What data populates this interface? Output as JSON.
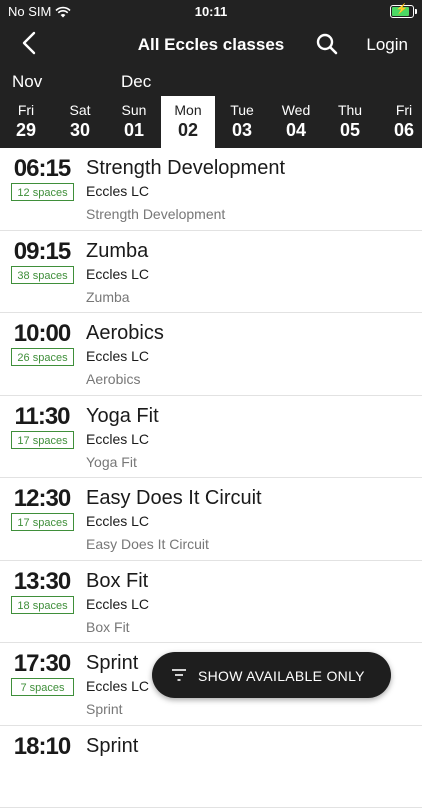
{
  "status": {
    "carrier": "No SIM",
    "time": "10:11"
  },
  "nav": {
    "title": "All Eccles classes",
    "login": "Login",
    "back_icon": "back-chevron-icon",
    "search_icon": "search-icon"
  },
  "months": {
    "first": "Nov",
    "second": "Dec"
  },
  "days": [
    {
      "wd": "Fri",
      "dn": "29"
    },
    {
      "wd": "Sat",
      "dn": "30"
    },
    {
      "wd": "Sun",
      "dn": "01"
    },
    {
      "wd": "Mon",
      "dn": "02"
    },
    {
      "wd": "Tue",
      "dn": "03"
    },
    {
      "wd": "Wed",
      "dn": "04"
    },
    {
      "wd": "Thu",
      "dn": "05"
    },
    {
      "wd": "Fri",
      "dn": "06"
    }
  ],
  "selected_day_index": 3,
  "classes": [
    {
      "time": "06:15",
      "spaces": "12 spaces",
      "name": "Strength Development",
      "venue": "Eccles LC",
      "type": "Strength Development"
    },
    {
      "time": "09:15",
      "spaces": "38 spaces",
      "name": "Zumba",
      "venue": "Eccles LC",
      "type": "Zumba"
    },
    {
      "time": "10:00",
      "spaces": "26 spaces",
      "name": "Aerobics",
      "venue": "Eccles LC",
      "type": "Aerobics"
    },
    {
      "time": "11:30",
      "spaces": "17 spaces",
      "name": "Yoga Fit",
      "venue": "Eccles LC",
      "type": "Yoga Fit"
    },
    {
      "time": "12:30",
      "spaces": "17 spaces",
      "name": "Easy Does It Circuit",
      "venue": "Eccles LC",
      "type": "Easy Does It Circuit"
    },
    {
      "time": "13:30",
      "spaces": "18 spaces",
      "name": "Box Fit",
      "venue": "Eccles LC",
      "type": "Box Fit"
    },
    {
      "time": "17:30",
      "spaces": "7 spaces",
      "name": "Sprint",
      "venue": "Eccles LC",
      "type": "Sprint"
    },
    {
      "time": "18:10",
      "spaces": "",
      "name": "Sprint",
      "venue": "",
      "type": ""
    }
  ],
  "fab": {
    "label": "SHOW AVAILABLE ONLY",
    "icon": "filter-icon"
  },
  "colors": {
    "header": "#222222",
    "spaces_green": "#3f8f3a",
    "battery_green": "#4cd964"
  }
}
